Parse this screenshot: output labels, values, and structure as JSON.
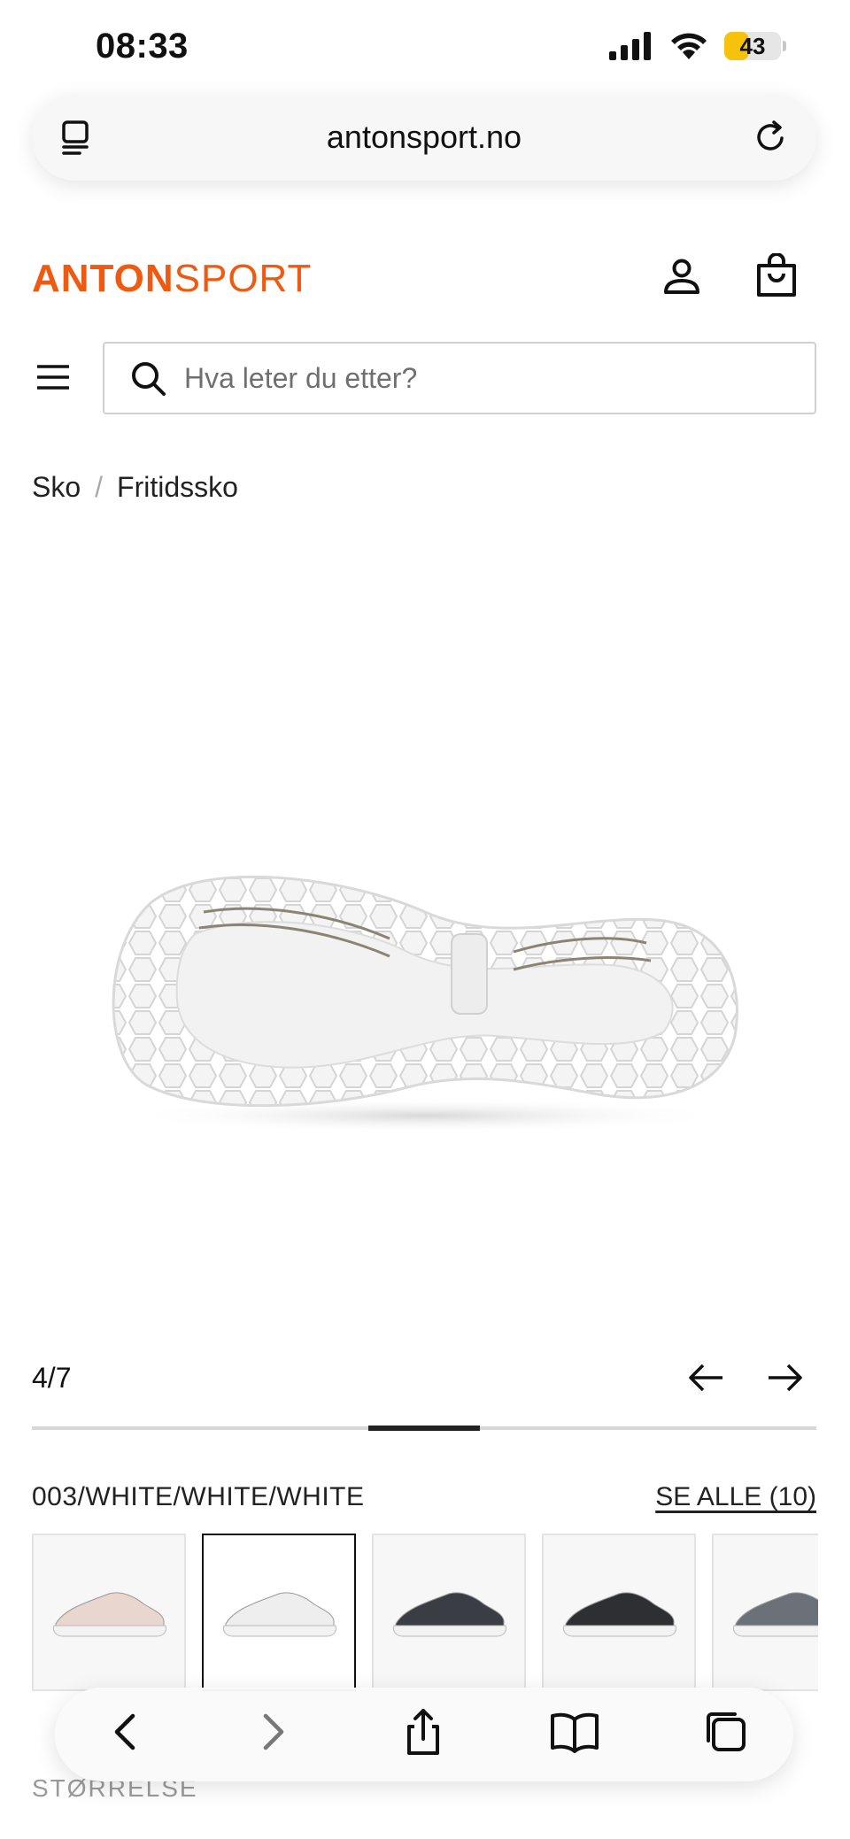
{
  "status_bar": {
    "time": "08:33",
    "battery": "43",
    "battery_level": 0.43
  },
  "browser": {
    "url": "antonsport.no"
  },
  "site": {
    "logo_primary": "ANTON",
    "logo_secondary": "SPORT",
    "brand_color": "#ee5a12"
  },
  "search": {
    "placeholder": "Hva leter du etter?"
  },
  "breadcrumb": {
    "items": [
      "Sko",
      "Fritidssko"
    ],
    "separator": "/"
  },
  "gallery": {
    "counter": "4/7",
    "current": 4,
    "total": 7
  },
  "variants": {
    "selected_label": "003/WHITE/WHITE/WHITE",
    "see_all": "SE ALLE (10)",
    "items": [
      {
        "name": "pink-shoe",
        "color": "#e8d6cf"
      },
      {
        "name": "white-shoe",
        "color": "#eeeeee",
        "selected": true
      },
      {
        "name": "black-shoe",
        "color": "#3a3d44"
      },
      {
        "name": "black-white-shoe",
        "color": "#2d2f33"
      },
      {
        "name": "grey-shoe",
        "color": "#6c7079"
      }
    ]
  },
  "size": {
    "label": "STØRRELSE"
  },
  "icons": [
    "tabs-icon",
    "reload-icon",
    "account-icon",
    "bag-icon",
    "menu-icon",
    "search-icon",
    "arrow-left-icon",
    "arrow-right-icon",
    "back-icon",
    "forward-icon",
    "share-icon",
    "bookmarks-icon",
    "tabs-overview-icon"
  ]
}
